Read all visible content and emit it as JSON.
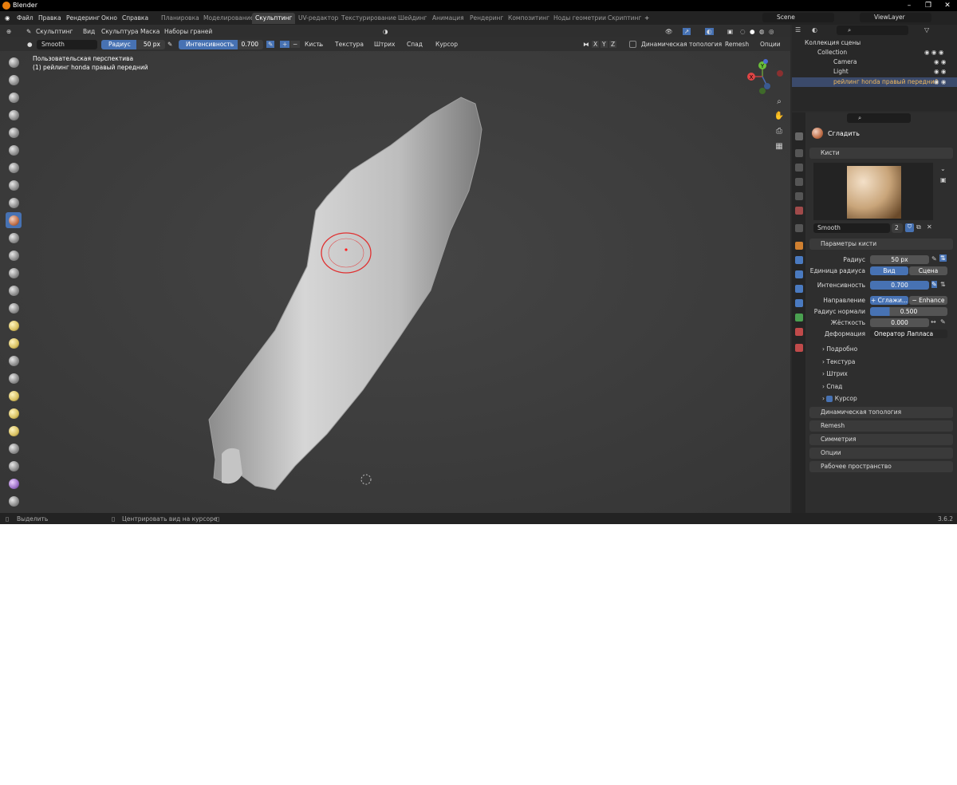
{
  "app": {
    "title": "Blender",
    "minimize": "–",
    "maximize": "❐",
    "close": "✕"
  },
  "menu": {
    "items": [
      "Файл",
      "Правка",
      "Рендеринг",
      "Окно",
      "Справка"
    ],
    "workspaces": [
      "Планировка",
      "Моделирование",
      "Скульптинг",
      "UV-редактор",
      "Текстурирование",
      "Шейдинг",
      "Анимация",
      "Рендеринг",
      "Композитинг",
      "Ноды геометрии",
      "Скриптинг"
    ],
    "add_workspace": "+",
    "scene": "Scene",
    "view_layer": "ViewLayer"
  },
  "header": {
    "mode": "Скульптинг",
    "items": [
      "Вид",
      "Скульптура",
      "Маска",
      "Наборы граней"
    ]
  },
  "tool": {
    "brush": "Smooth",
    "radius_label": "Радиус",
    "radius_value": "50 px",
    "radius_fraction": 0.55,
    "strength_label": "Интенсивность",
    "strength_value": "0.700",
    "strength_fraction": 0.7,
    "plus": "+",
    "minus": "−",
    "menus": [
      "Кисть",
      "Текстура",
      "Штрих",
      "Спад",
      "Курсор"
    ],
    "axes": [
      "X",
      "Y",
      "Z"
    ],
    "dyntopo": "Динамическая топология",
    "remesh": "Remesh",
    "options": "Опции"
  },
  "viewport": {
    "perspective": "Пользовательская перспектива",
    "object": "(1) рейлинг honda правый передний",
    "gizmo": {
      "x": "X",
      "y": "Y",
      "z": "Z"
    }
  },
  "outliner": {
    "root": "Коллекция сцены",
    "collection": "Collection",
    "items": [
      "Camera",
      "Light",
      "рейлинг honda правый передний"
    ]
  },
  "properties": {
    "tool_name": "Сгладить",
    "brushes_panel": "Кисти",
    "brush_name": "Smooth",
    "brush_users": "2",
    "params_panel": "Параметры кисти",
    "radius_label": "Радиус",
    "radius_value": "50 px",
    "radius_unit_label": "Единица радиуса",
    "radius_unit_options": [
      "Вид",
      "Сцена"
    ],
    "strength_label": "Интенсивность",
    "strength_value": "0.700",
    "direction_label": "Направление",
    "direction_options": [
      "+ Сглажи...",
      "− Enhance ..."
    ],
    "normal_radius_label": "Радиус нормали",
    "normal_radius_value": "0.500",
    "hardness_label": "Жёсткость",
    "hardness_value": "0.000",
    "deform_label": "Деформация",
    "deform_value": "Оператор Лапласа",
    "subpanels": [
      "Подробно",
      "Текстура",
      "Штрих",
      "Спад",
      "Курсор"
    ],
    "panels": [
      "Динамическая топология",
      "Remesh",
      "Симметрия",
      "Опции",
      "Рабочее пространство"
    ]
  },
  "status": {
    "select": "Выделить",
    "center": "Центрировать вид на курсоре",
    "version": "3.6.2"
  }
}
